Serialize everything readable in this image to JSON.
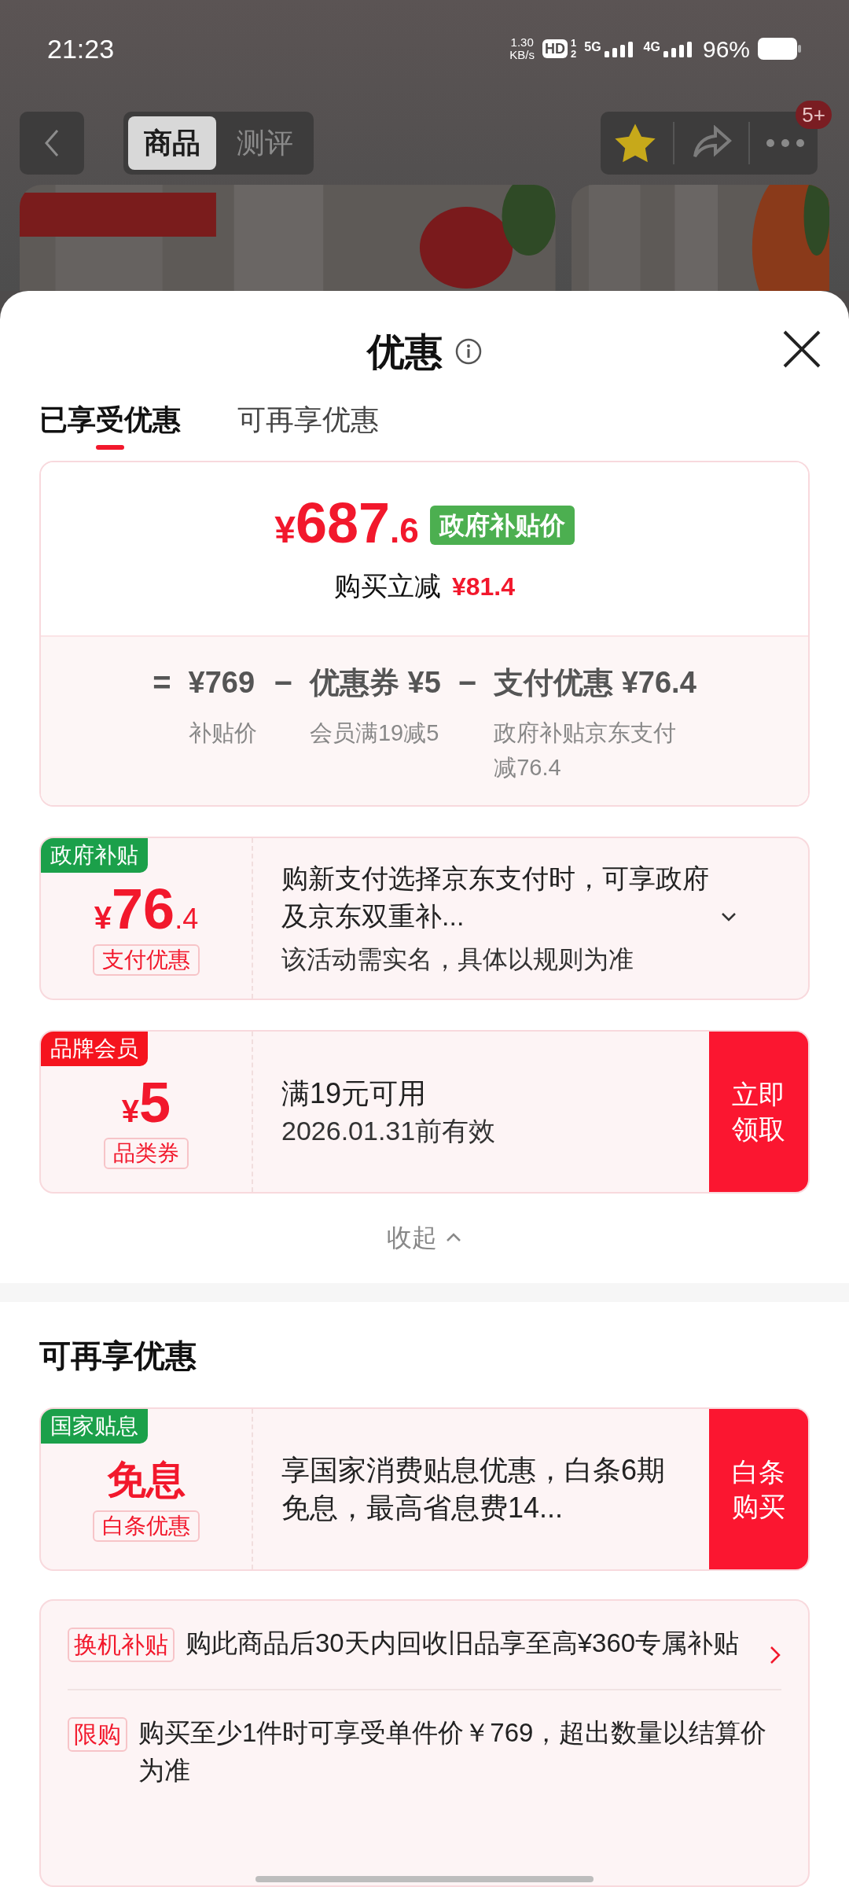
{
  "status_bar": {
    "time": "21:23",
    "net_speed_value": "1.30",
    "net_speed_unit": "KB/s",
    "hd": "HD",
    "hd_slots": [
      "1",
      "2"
    ],
    "networks": [
      {
        "label": "5G"
      },
      {
        "label": "4G"
      }
    ],
    "battery": "96%"
  },
  "header": {
    "tabs": [
      {
        "label": "商品",
        "selected": true
      },
      {
        "label": "测评",
        "selected": false
      }
    ],
    "badge": "5+"
  },
  "sheet": {
    "title": "优惠",
    "tabs": [
      {
        "label": "已享受优惠",
        "selected": true
      },
      {
        "label": "可再享优惠",
        "selected": false
      }
    ]
  },
  "price_card": {
    "symbol": "¥",
    "price_integer": "687",
    "price_decimal": ".6",
    "price_tag": "政府补贴价",
    "reduction_label": "购买立减",
    "reduction": "¥81.4",
    "breakdown": [
      {
        "operator": "=",
        "value": "¥769",
        "note": "补贴价"
      },
      {
        "operator": "−",
        "value": "优惠券 ¥5",
        "note": "会员满19减5"
      },
      {
        "operator": "−",
        "value": "支付优惠 ¥76.4",
        "note": "政府补贴京东支付减76.4"
      }
    ]
  },
  "coupons": [
    {
      "kind": "amount",
      "tag": "政府补贴",
      "color": "#1ba04a",
      "symbol": "¥",
      "amount": "76",
      "decimal": ".4",
      "type_label": "支付优惠",
      "title": "购新支付选择京东支付时，可享政府及京东双重补...",
      "expandable": true,
      "subtitle": "该活动需实名，具体以规则为准"
    },
    {
      "kind": "amount",
      "tag": "品牌会员",
      "color": "#f5141e",
      "symbol": "¥",
      "amount": "5",
      "type_label": "品类券",
      "title": "满19元可用",
      "expandable": false,
      "subtitle": "2026.01.31前有效",
      "action": "立即领取"
    }
  ],
  "collapse": "收起",
  "more_section": {
    "title": "可再享优惠",
    "coupons": [
      {
        "kind": "text",
        "tag": "国家贴息",
        "color": "#1ba04a",
        "main": "免息",
        "type_label": "白条优惠",
        "title": "享国家消费贴息优惠，白条6期免息，最高省息费14...",
        "expandable": false,
        "action": "白条购买"
      }
    ],
    "rules": [
      {
        "tag": "换机补贴",
        "text": "购此商品后30天内回收旧品享至高¥360专属补贴",
        "has_arrow": true
      },
      {
        "tag": "限购",
        "text": "购买至少1件时可享受单件价￥769，超出数量以结算价为准",
        "has_arrow": false
      }
    ]
  }
}
